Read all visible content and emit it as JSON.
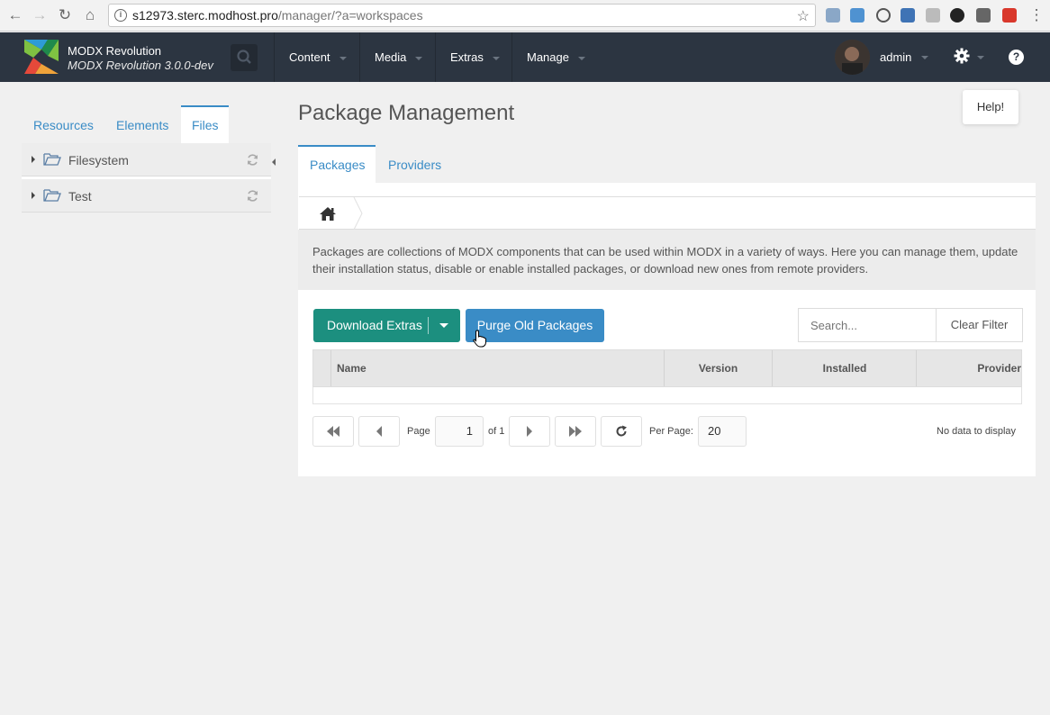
{
  "browser": {
    "url_host": "s12973.sterc.modhost.pro",
    "url_path": "/manager/?a=workspaces"
  },
  "header": {
    "brand_name": "MODX Revolution",
    "brand_version": "MODX Revolution 3.0.0-dev",
    "nav": [
      "Content",
      "Media",
      "Extras",
      "Manage"
    ],
    "user": "admin"
  },
  "left": {
    "tabs": [
      "Resources",
      "Elements",
      "Files"
    ],
    "active_tab": "Files",
    "tree": [
      {
        "label": "Filesystem"
      },
      {
        "label": "Test"
      }
    ]
  },
  "main": {
    "title": "Package Management",
    "help_label": "Help!",
    "tabs": [
      "Packages",
      "Providers"
    ],
    "active_tab": "Packages",
    "description": "Packages are collections of MODX components that can be used within MODX in a variety of ways. Here you can manage them, update their installation status, disable or enable installed packages, or download new ones from remote providers.",
    "download_label": "Download Extras",
    "purge_label": "Purge Old Packages",
    "search_placeholder": "Search...",
    "clear_filter_label": "Clear Filter",
    "columns": [
      "Name",
      "Version",
      "Installed",
      "Provider"
    ],
    "pager": {
      "page_label": "Page",
      "page_value": "1",
      "of_label": "of 1",
      "per_page_label": "Per Page:",
      "per_page_value": "20",
      "empty_text": "No data to display"
    }
  },
  "colors": {
    "header_bg": "#2c3541",
    "accent_blue": "#3a8cc6",
    "accent_green": "#1c8f7f"
  }
}
